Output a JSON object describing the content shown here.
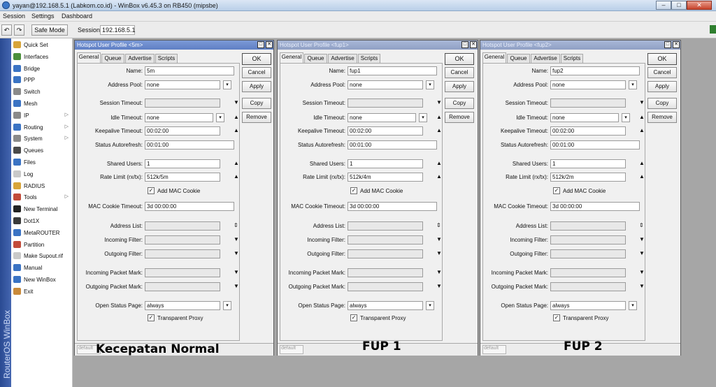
{
  "window": {
    "title": "yayan@192.168.5.1 (Labkom.co.id) - WinBox v6.45.3 on RB450 (mipsbe)",
    "minimize": "–",
    "maximize": "□",
    "close": "✕"
  },
  "menu": {
    "session": "Session",
    "settings": "Settings",
    "dashboard": "Dashboard"
  },
  "toolbar": {
    "undo": "↶",
    "redo": "↷",
    "safe_mode": "Safe Mode",
    "session_label": "Session:",
    "session_value": "192.168.5.1"
  },
  "sidebar": {
    "brand": "RouterOS WinBox",
    "items": [
      {
        "label": "Quick Set",
        "icon": "quick-set-icon",
        "color": "#d8a53a"
      },
      {
        "label": "Interfaces",
        "icon": "interfaces-icon",
        "color": "#4b8f3b"
      },
      {
        "label": "Bridge",
        "icon": "bridge-icon",
        "color": "#3a73c4"
      },
      {
        "label": "PPP",
        "icon": "ppp-icon",
        "color": "#3a73c4"
      },
      {
        "label": "Switch",
        "icon": "switch-icon",
        "color": "#8a8a8a"
      },
      {
        "label": "Mesh",
        "icon": "mesh-icon",
        "color": "#3a73c4"
      },
      {
        "label": "IP",
        "icon": "ip-icon",
        "color": "#8a8a8a"
      },
      {
        "label": "Routing",
        "icon": "routing-icon",
        "color": "#3a73c4"
      },
      {
        "label": "System",
        "icon": "system-icon",
        "color": "#8a8a8a"
      },
      {
        "label": "Queues",
        "icon": "queues-icon",
        "color": "#4a4a4a"
      },
      {
        "label": "Files",
        "icon": "files-icon",
        "color": "#3a73c4"
      },
      {
        "label": "Log",
        "icon": "log-icon",
        "color": "#c9c9c9"
      },
      {
        "label": "RADIUS",
        "icon": "radius-icon",
        "color": "#d8a53a"
      },
      {
        "label": "Tools",
        "icon": "tools-icon",
        "color": "#c24b3a"
      },
      {
        "label": "New Terminal",
        "icon": "terminal-icon",
        "color": "#222222"
      },
      {
        "label": "Dot1X",
        "icon": "dot1x-icon",
        "color": "#3a3a3a"
      },
      {
        "label": "MetaROUTER",
        "icon": "metarouter-icon",
        "color": "#3a73c4"
      },
      {
        "label": "Partition",
        "icon": "partition-icon",
        "color": "#c24b3a"
      },
      {
        "label": "Make Supout.rif",
        "icon": "supout-icon",
        "color": "#c9c9c9"
      },
      {
        "label": "Manual",
        "icon": "manual-icon",
        "color": "#3a73c4"
      },
      {
        "label": "New WinBox",
        "icon": "winbox-icon",
        "color": "#3a73c4"
      },
      {
        "label": "Exit",
        "icon": "exit-icon",
        "color": "#c98a3a"
      }
    ]
  },
  "labels": {
    "name": "Name:",
    "address_pool": "Address Pool:",
    "session_timeout": "Session Timeout:",
    "idle_timeout": "Idle Timeout:",
    "keepalive_timeout": "Keepalive Timeout:",
    "status_autorefresh": "Status Autorefresh:",
    "shared_users": "Shared Users:",
    "rate_limit": "Rate Limit (rx/tx):",
    "add_mac_cookie": "Add MAC Cookie",
    "mac_cookie_timeout": "MAC Cookie Timeout:",
    "address_list": "Address List:",
    "incoming_filter": "Incoming Filter:",
    "outgoing_filter": "Outgoing Filter:",
    "incoming_packet_mark": "Incoming Packet Mark:",
    "outgoing_packet_mark": "Outgoing Packet Mark:",
    "open_status_page": "Open Status Page:",
    "transparent_proxy": "Transparent Proxy"
  },
  "tabs": [
    "General",
    "Queue",
    "Advertise",
    "Scripts"
  ],
  "actions": {
    "ok": "OK",
    "cancel": "Cancel",
    "apply": "Apply",
    "copy": "Copy",
    "remove": "Remove"
  },
  "dialogs": [
    {
      "title": "Hotspot User Profile <5m>",
      "name": "5m",
      "address_pool": "none",
      "idle_timeout": "none",
      "keepalive_timeout": "00:02:00",
      "status_autorefresh": "00:01:00",
      "shared_users": "1",
      "rate_limit": "512k/5m",
      "add_mac_cookie": true,
      "mac_cookie_timeout": "3d 00:00:00",
      "open_status_page": "always",
      "transparent_proxy": true,
      "status": "default",
      "caption": "Kecepatan Normal"
    },
    {
      "title": "Hotspot User Profile <fup1>",
      "name": "fup1",
      "address_pool": "none",
      "idle_timeout": "none",
      "keepalive_timeout": "00:02:00",
      "status_autorefresh": "00:01:00",
      "shared_users": "1",
      "rate_limit": "512k/4m",
      "add_mac_cookie": true,
      "mac_cookie_timeout": "3d 00:00:00",
      "open_status_page": "always",
      "transparent_proxy": true,
      "status": "default",
      "caption": "FUP 1"
    },
    {
      "title": "Hotspot User Profile <fup2>",
      "name": "fup2",
      "address_pool": "none",
      "idle_timeout": "none",
      "keepalive_timeout": "00:02:00",
      "status_autorefresh": "00:01:00",
      "shared_users": "1",
      "rate_limit": "512k/2m",
      "add_mac_cookie": true,
      "mac_cookie_timeout": "3d 00:00:00",
      "open_status_page": "always",
      "transparent_proxy": true,
      "status": "default",
      "caption": "FUP 2"
    }
  ]
}
